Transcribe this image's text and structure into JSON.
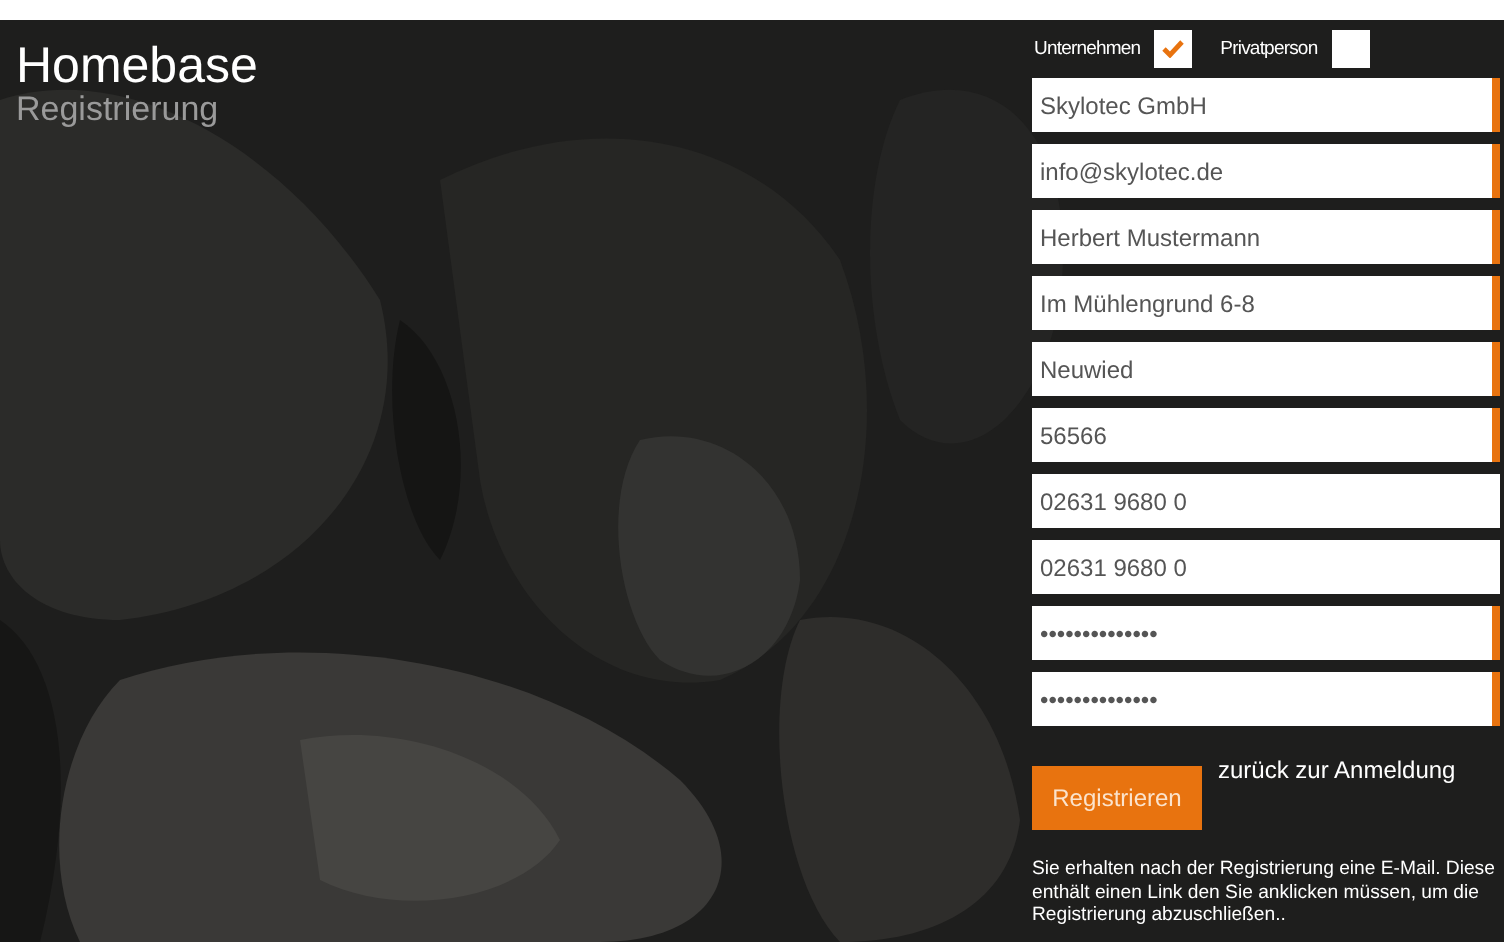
{
  "header": {
    "title": "Homebase",
    "subtitle": "Registrierung"
  },
  "account_types": [
    {
      "label": "Unternehmen",
      "checked": true
    },
    {
      "label": "Privatperson",
      "checked": false
    }
  ],
  "fields": [
    {
      "value": "Skylotec GmbH",
      "required": true
    },
    {
      "value": "info@skylotec.de",
      "required": true
    },
    {
      "value": "Herbert Mustermann",
      "required": true
    },
    {
      "value": "Im Mühlengrund 6-8",
      "required": true
    },
    {
      "value": "Neuwied",
      "required": true
    },
    {
      "value": "56566",
      "required": true
    },
    {
      "value": "02631 9680 0",
      "required": false
    },
    {
      "value": "02631 9680 0",
      "required": false
    },
    {
      "value": "••••••••••••••",
      "required": true
    },
    {
      "value": "••••••••••••••",
      "required": true
    }
  ],
  "submit_button": "Registrieren",
  "back_link": "zurück zur Anmeldung",
  "note": "Sie erhalten nach der Registrierung eine E-Mail. Diese enthält einen Link den Sie anklicken müssen, um die Registrierung abzuschließen.."
}
